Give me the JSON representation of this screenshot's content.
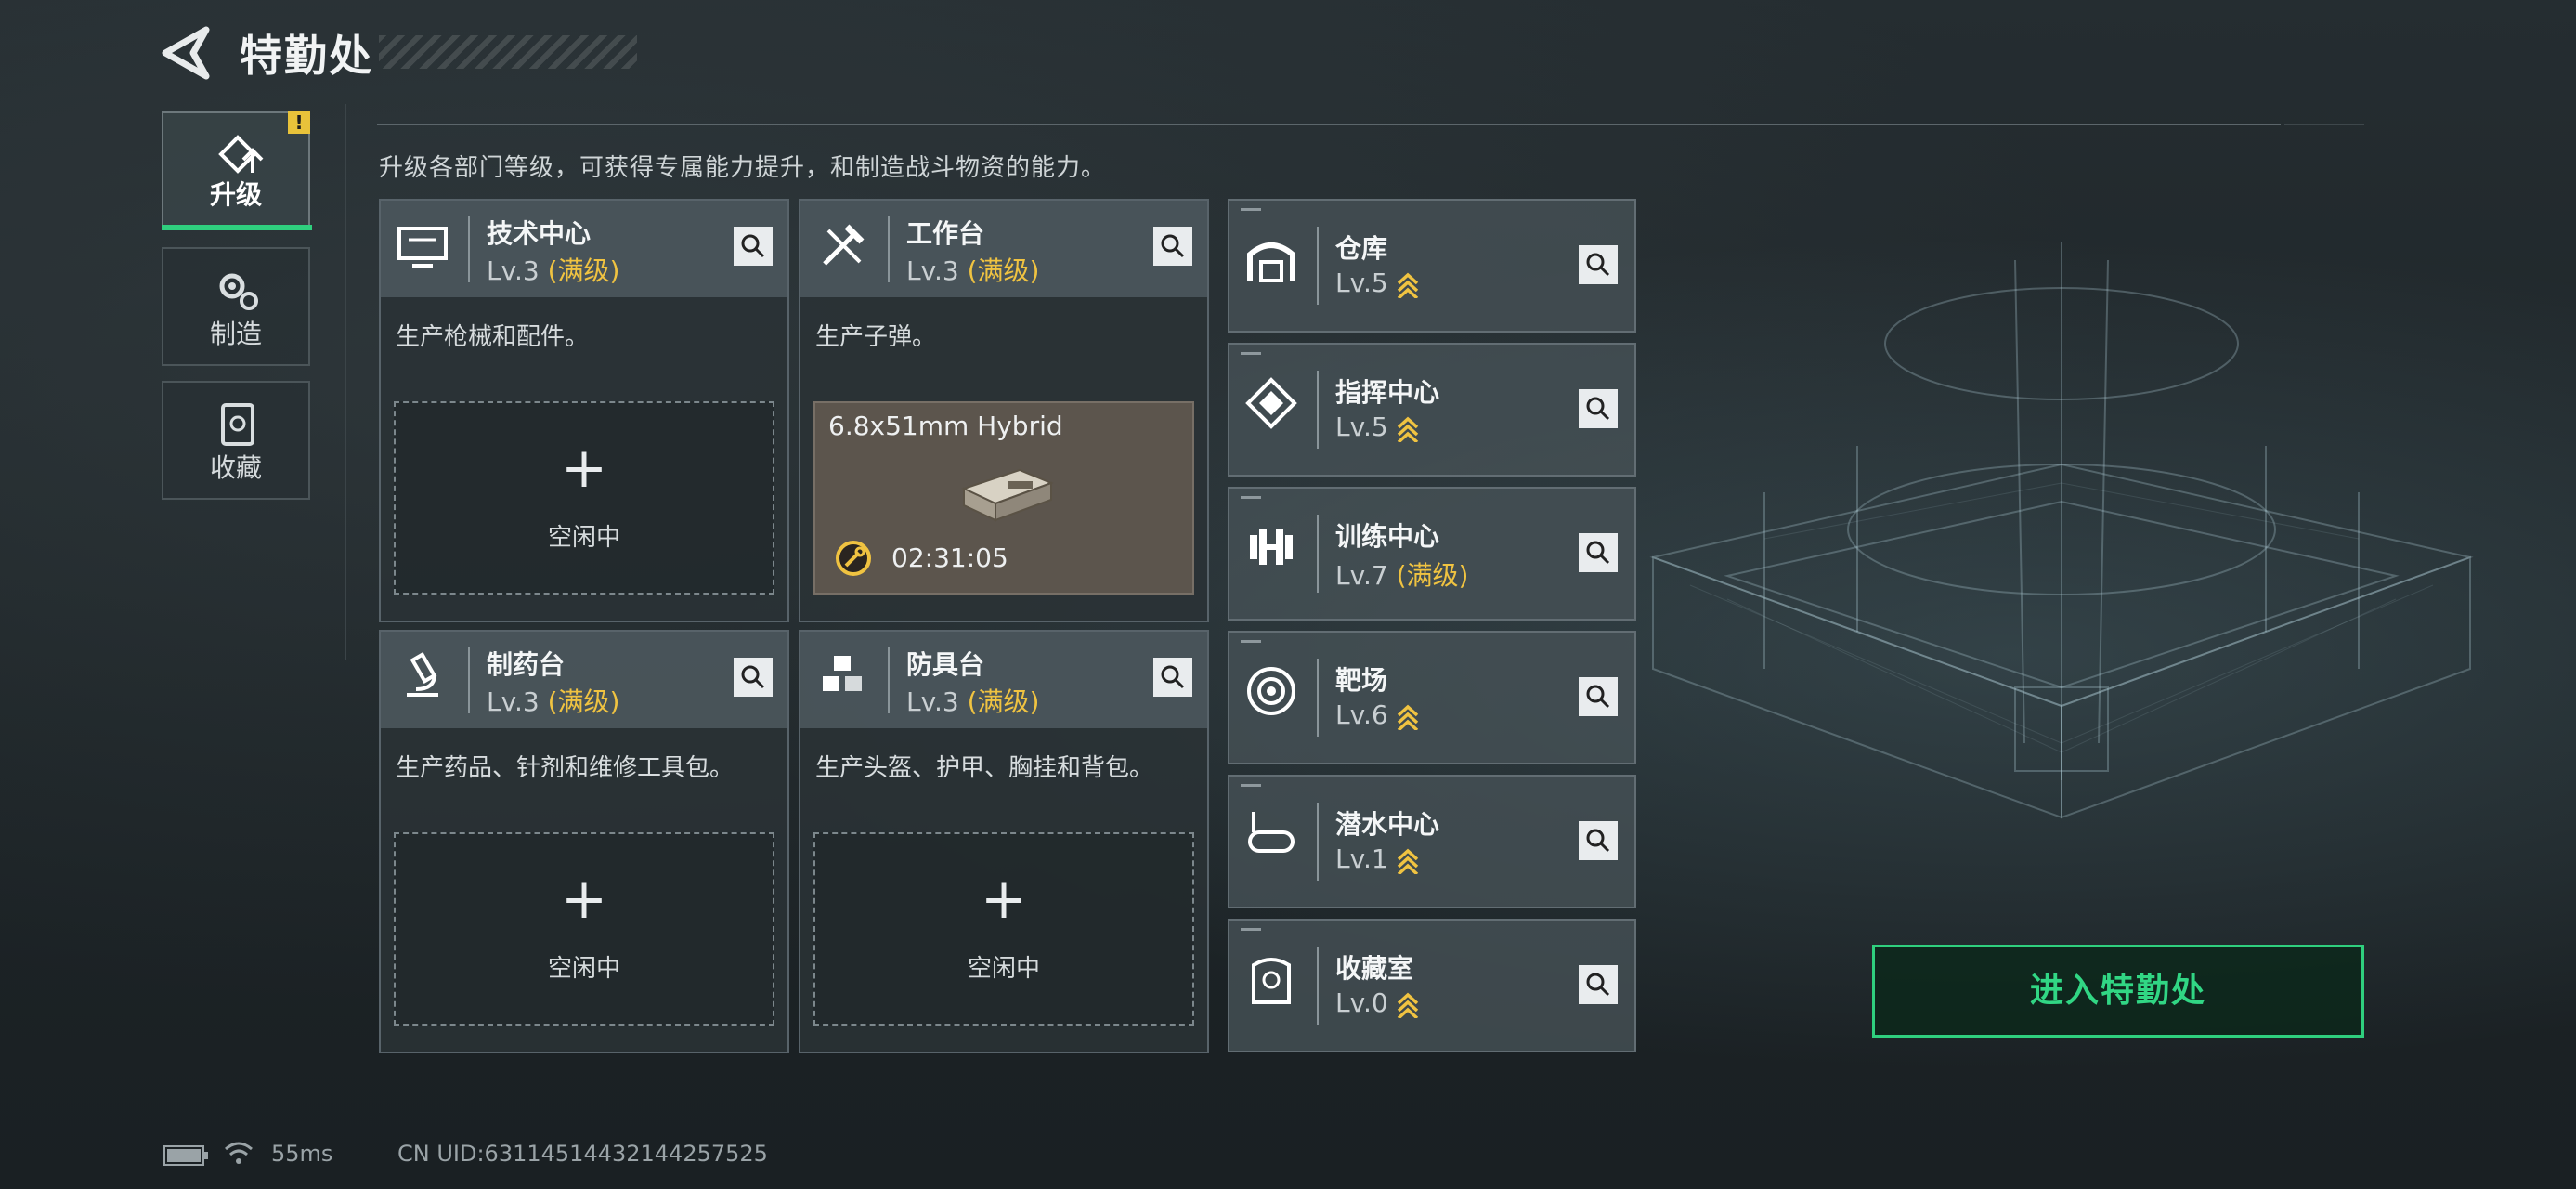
{
  "header": {
    "title": "特勤处"
  },
  "nav": [
    {
      "label": "升级",
      "icon": "upgrade-icon",
      "active": true,
      "alert": "!"
    },
    {
      "label": "制造",
      "icon": "gears-icon",
      "active": false
    },
    {
      "label": "收藏",
      "icon": "collection-icon",
      "active": false
    }
  ],
  "intro": "升级各部门等级，可获得专属能力提升，和制造战斗物资的能力。",
  "cards": [
    {
      "name": "技术中心",
      "level": "Lv.3",
      "max": "(满级)",
      "desc": "生产枪械和配件。",
      "icon": "monitor-icon",
      "slot": {
        "plus": "+",
        "idle": "空闲中"
      }
    },
    {
      "name": "工作台",
      "level": "Lv.3",
      "max": "(满级)",
      "desc": "生产子弹。",
      "icon": "tools-icon",
      "production": {
        "item": "6.8x51mm Hybrid",
        "timer": "02:31:05",
        "icon": "wrench-timer-icon"
      }
    },
    {
      "name": "制药台",
      "level": "Lv.3",
      "max": "(满级)",
      "desc": "生产药品、针剂和维修工具包。",
      "icon": "microscope-icon",
      "slot": {
        "plus": "+",
        "idle": "空闲中"
      }
    },
    {
      "name": "防具台",
      "level": "Lv.3",
      "max": "(满级)",
      "desc": "生产头盔、护甲、胸挂和背包。",
      "icon": "armor-blocks-icon",
      "slot": {
        "plus": "+",
        "idle": "空闲中"
      }
    }
  ],
  "facilities": [
    {
      "name": "仓库",
      "level": "Lv.5",
      "upgradeable": true,
      "icon": "warehouse-icon"
    },
    {
      "name": "指挥中心",
      "level": "Lv.5",
      "upgradeable": true,
      "icon": "command-chip-icon"
    },
    {
      "name": "训练中心",
      "level": "Lv.7",
      "max": "(满级)",
      "upgradeable": false,
      "icon": "dumbbell-icon"
    },
    {
      "name": "靶场",
      "level": "Lv.6",
      "upgradeable": true,
      "icon": "target-icon"
    },
    {
      "name": "潜水中心",
      "level": "Lv.1",
      "upgradeable": true,
      "icon": "diving-mask-icon"
    },
    {
      "name": "收藏室",
      "level": "Lv.0",
      "upgradeable": true,
      "icon": "trophy-case-icon"
    }
  ],
  "enter_button": "进入特勤处",
  "footer": {
    "ping": "55ms",
    "uid": "CN UID:63114514432144257525"
  },
  "colors": {
    "accent_green": "#2fcf7e",
    "max_gold": "#f0c341",
    "alert_yellow": "#e8c23a"
  }
}
